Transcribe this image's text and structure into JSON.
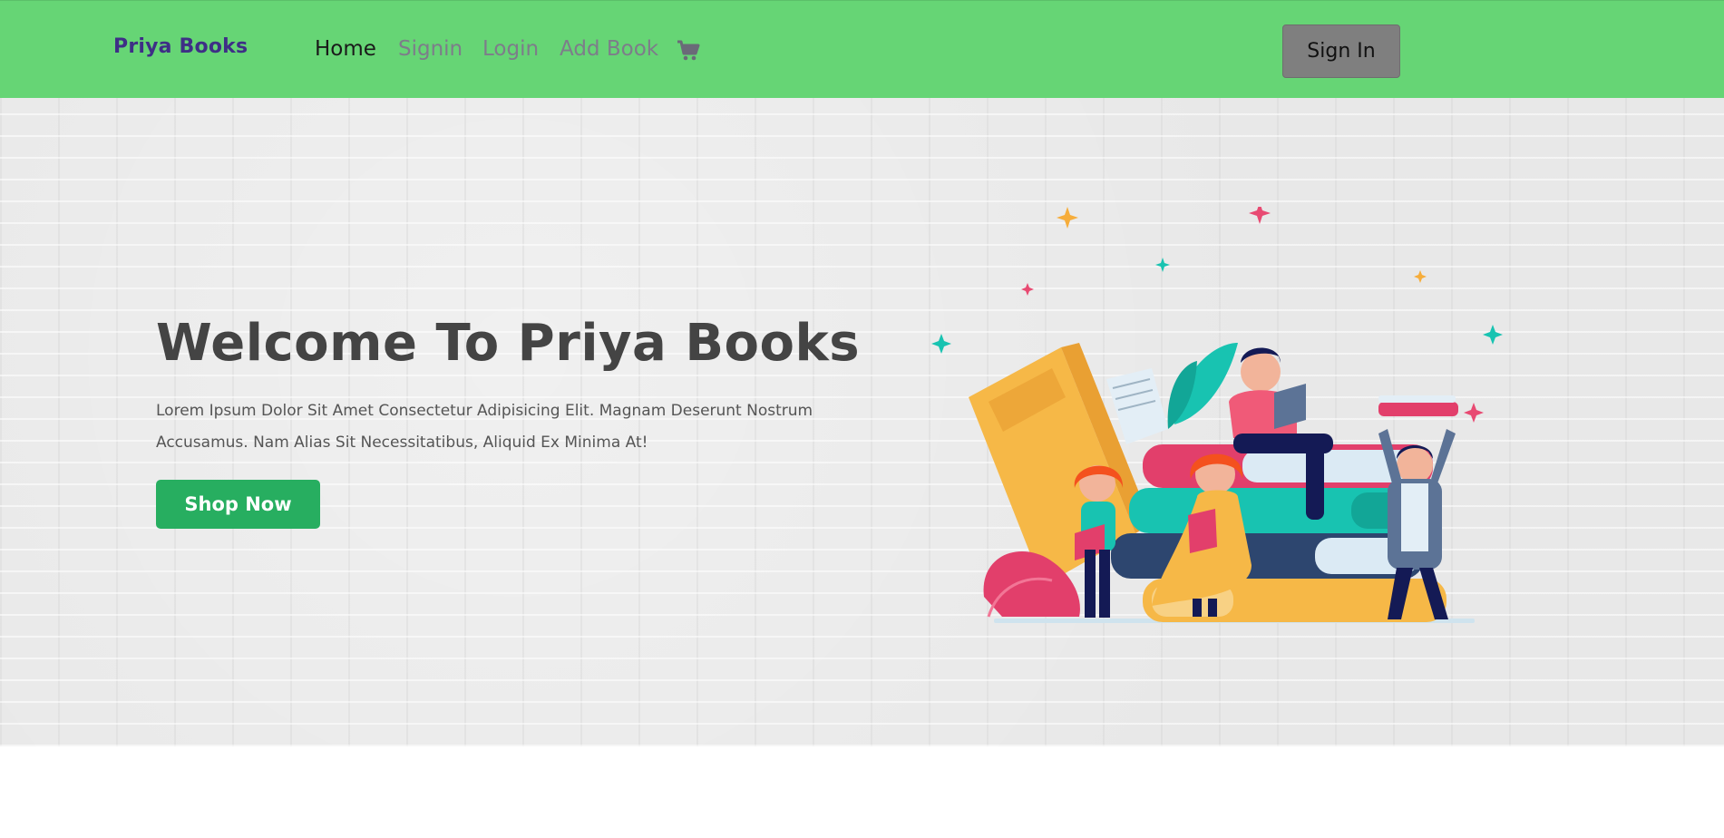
{
  "navbar": {
    "brand": "Priya Books",
    "links": [
      {
        "label": "Home",
        "active": true
      },
      {
        "label": "Signin",
        "active": false
      },
      {
        "label": "Login",
        "active": false
      },
      {
        "label": "Add Book",
        "active": false
      }
    ],
    "cart_icon": "shopping-cart-icon",
    "signin_button": "Sign In"
  },
  "hero": {
    "title": "Welcome To Priya Books",
    "text": "Lorem Ipsum Dolor Sit Amet Consectetur Adipisicing Elit. Magnam Deserunt Nostrum Accusamus. Nam Alias Sit Necessitatibus, Aliquid Ex Minima At!",
    "button": "Shop Now",
    "illustration": "people-reading-books-illustration"
  },
  "colors": {
    "navbar_bg": "#66d575",
    "brand": "#3e2f86",
    "shop_button": "#27ae60",
    "signin_button": "#7f7f7f",
    "title": "#444444"
  }
}
